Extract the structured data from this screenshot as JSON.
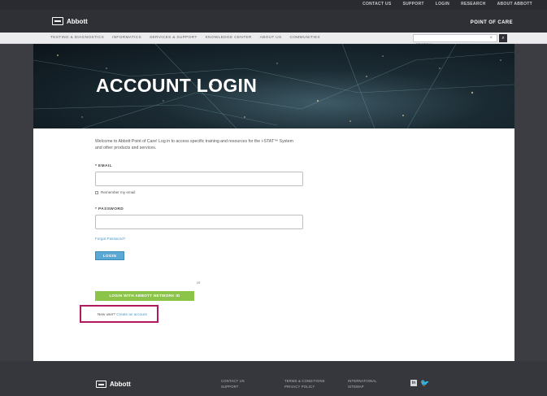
{
  "utility_nav": [
    "CONTACT US",
    "SUPPORT",
    "LOGIN",
    "RESEARCH",
    "ABOUT ABBOTT"
  ],
  "brand": {
    "logo_text": "Abbott",
    "section_title": "POINT OF CARE"
  },
  "main_nav": [
    "TESTING & DIAGNOSTICS",
    "INFORMATICS",
    "SERVICES & SUPPORT",
    "KNOWLEDGE CENTER",
    "ABOUT US",
    "COMMUNITIES"
  ],
  "search": {
    "placeholder": "SEARCH",
    "clear_icon": "×",
    "button_icon": "magnifier-icon"
  },
  "hero": {
    "title": "ACCOUNT LOGIN"
  },
  "form": {
    "intro": "Welcome to Abbott Point of Care! Log in to access specific training and resources for the i-STAT™ System and other products and services.",
    "email_label": "* EMAIL",
    "email_value": "",
    "remember_label": "Remember my email",
    "password_label": "* PASSWORD",
    "password_value": "",
    "forgot_label": "Forgot Password?",
    "login_label": "LOGIN",
    "or_label": "or",
    "network_login_label": "LOGIN WITH ABBOTT NETWORK ID",
    "signup_prefix": "New user?",
    "signup_link": "Create an account"
  },
  "footer": {
    "logo_text": "Abbott",
    "col1": [
      "CONTACT US",
      "SUPPORT"
    ],
    "col2": [
      "TERMS & CONDITIONS",
      "PRIVACY POLICY"
    ],
    "col3": [
      "INTERNATIONAL",
      "SITEMAP"
    ],
    "social": [
      "linkedin-icon",
      "twitter-icon"
    ]
  },
  "colors": {
    "highlight": "#b0185f",
    "accent_blue": "#5aa8d4",
    "accent_green": "#8cc44a"
  }
}
